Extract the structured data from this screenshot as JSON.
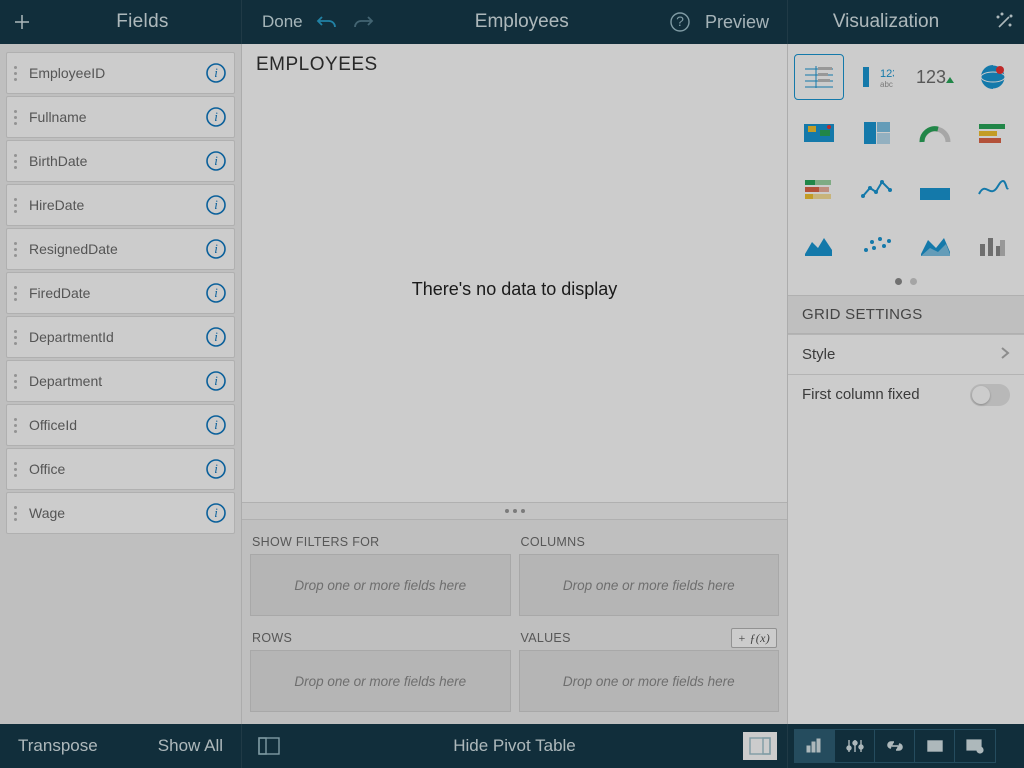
{
  "header": {
    "fields_title": "Fields",
    "done": "Done",
    "center_title": "Employees",
    "preview": "Preview",
    "viz_title": "Visualization"
  },
  "fields": [
    {
      "name": "EmployeeID"
    },
    {
      "name": "Fullname"
    },
    {
      "name": "BirthDate"
    },
    {
      "name": "HireDate"
    },
    {
      "name": "ResignedDate"
    },
    {
      "name": "FiredDate"
    },
    {
      "name": "DepartmentId"
    },
    {
      "name": "Department"
    },
    {
      "name": "OfficeId"
    },
    {
      "name": "Office"
    },
    {
      "name": "Wage"
    }
  ],
  "canvas": {
    "dataset_label": "EMPLOYEES",
    "empty_message": "There's no data to display"
  },
  "pivot": {
    "filters_label": "SHOW FILTERS FOR",
    "columns_label": "COLUMNS",
    "rows_label": "ROWS",
    "values_label": "VALUES",
    "fx_label": "+ ƒ(x)",
    "placeholder": "Drop one or more fields here"
  },
  "viz_panel": {
    "items": [
      {
        "name": "grid",
        "glyph": "grid",
        "color": "#1a98d5",
        "selected": true
      },
      {
        "name": "text-123",
        "glyph": "text123",
        "color": "#1a98d5"
      },
      {
        "name": "kpi-number",
        "glyph": "kpi",
        "color": "#6f6f6f"
      },
      {
        "name": "geo-globe",
        "glyph": "globe",
        "color": "#1a98d5"
      },
      {
        "name": "heat-map",
        "glyph": "map",
        "color": "#1a98d5"
      },
      {
        "name": "treemap",
        "glyph": "treemap",
        "color": "#1a98d5"
      },
      {
        "name": "gauge",
        "glyph": "gauge",
        "color": "#2aa85a"
      },
      {
        "name": "stacked-bar-h",
        "glyph": "hbar",
        "color": "#2aa85a"
      },
      {
        "name": "stacked-bar-h-alt",
        "glyph": "hbar2",
        "color": "#2aa85a"
      },
      {
        "name": "line-sparse",
        "glyph": "line",
        "color": "#1a98d5"
      },
      {
        "name": "area-points",
        "glyph": "areadot",
        "color": "#1a98d5"
      },
      {
        "name": "spline",
        "glyph": "spline",
        "color": "#1a98d5"
      },
      {
        "name": "area",
        "glyph": "area",
        "color": "#1a98d5"
      },
      {
        "name": "scatter",
        "glyph": "scatter",
        "color": "#1a98d5"
      },
      {
        "name": "area-stacked",
        "glyph": "area2",
        "color": "#1a98d5"
      },
      {
        "name": "column",
        "glyph": "column",
        "color": "#8a8a8a"
      }
    ],
    "section_title": "GRID SETTINGS",
    "style_label": "Style",
    "first_col_label": "First column fixed"
  },
  "footer": {
    "transpose": "Transpose",
    "show_all": "Show All",
    "hide_pivot": "Hide Pivot Table"
  }
}
